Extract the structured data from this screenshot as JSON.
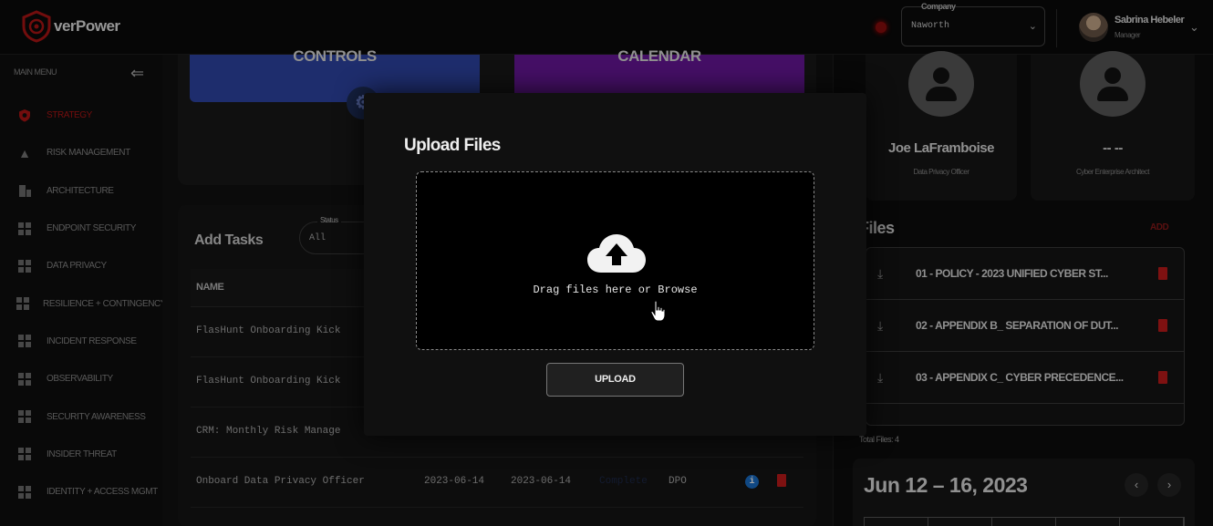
{
  "header": {
    "brand": "verPower",
    "company_label": "Company",
    "company_value": "Naworth",
    "user_name": "Sabrina Hebeler",
    "user_role": "Manager"
  },
  "sidebar": {
    "title": "MAIN MENU",
    "items": [
      {
        "label": "STRATEGY",
        "icon": "shield-icon",
        "active": true
      },
      {
        "label": "RISK MANAGEMENT",
        "icon": "warning-icon"
      },
      {
        "label": "ARCHITECTURE",
        "icon": "building-icon"
      },
      {
        "label": "ENDPOINT SECURITY",
        "icon": "grid-icon"
      },
      {
        "label": "DATA PRIVACY",
        "icon": "grid-icon"
      },
      {
        "label": "RESILIENCE + CONTINGENCY",
        "icon": "grid-icon"
      },
      {
        "label": "INCIDENT RESPONSE",
        "icon": "grid-icon"
      },
      {
        "label": "OBSERVABILITY",
        "icon": "grid-icon"
      },
      {
        "label": "SECURITY AWARENESS",
        "icon": "grid-icon"
      },
      {
        "label": "INSIDER THREAT",
        "icon": "grid-icon"
      },
      {
        "label": "IDENTITY + ACCESS MGMT",
        "icon": "grid-icon"
      }
    ]
  },
  "tiles": {
    "controls": "CONTROLS",
    "calendar": "CALENDAR"
  },
  "tasks": {
    "title": "Add Tasks",
    "status_label": "Status",
    "status_value": "All",
    "col_name": "NAME",
    "rows": [
      {
        "name": "FlasHunt Onboarding Kick",
        "start": "",
        "end": "",
        "status": "",
        "owner": ""
      },
      {
        "name": "FlasHunt Onboarding Kick",
        "start": "",
        "end": "",
        "status": "",
        "owner": ""
      },
      {
        "name": "CRM: Monthly Risk Manage",
        "start": "",
        "end": "",
        "status": "",
        "owner": ""
      },
      {
        "name": "Onboard Data Privacy Officer",
        "start": "2023-06-14",
        "end": "2023-06-14",
        "status": "Complete",
        "owner": "DPO"
      }
    ]
  },
  "people": [
    {
      "name": "Joe LaFramboise",
      "role": "Data Privacy Officer"
    },
    {
      "name": "-- --",
      "role": "Cyber Enterprise Architect"
    }
  ],
  "files": {
    "title": "Files",
    "add": "ADD",
    "items": [
      "01 - POLICY - 2023 UNIFIED CYBER ST...",
      "02 - APPENDIX B_ SEPARATION OF DUT...",
      "03 - APPENDIX C_ CYBER PRECEDENCE..."
    ],
    "total": "Total Files: 4"
  },
  "calendar": {
    "range": "Jun 12 – 16, 2023"
  },
  "modal": {
    "title": "Upload Files",
    "drop_text": "Drag files here or Browse",
    "upload_label": "UPLOAD"
  },
  "colors": {
    "accent_red": "#b01515",
    "controls": "#2f46a8",
    "calendar": "#6a179d",
    "info": "#1a6fc9"
  }
}
